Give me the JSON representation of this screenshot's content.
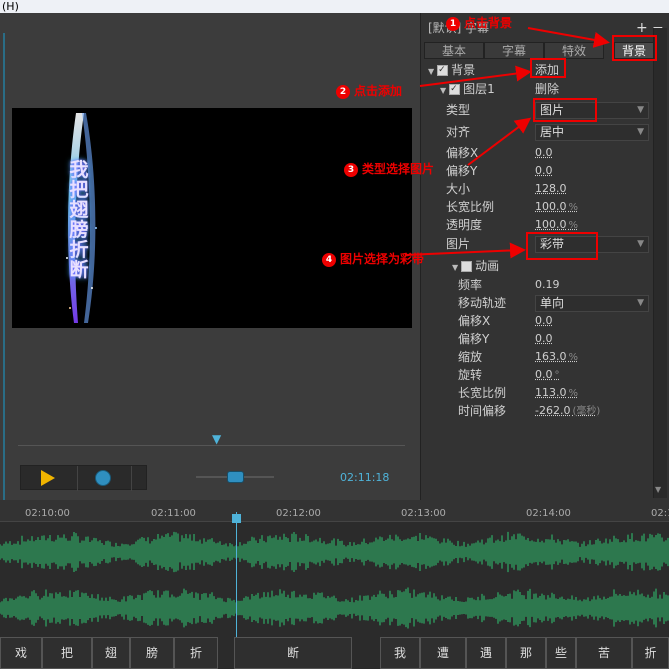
{
  "menu": {
    "label": "(H)"
  },
  "header": {
    "preset": "[默认] 字幕",
    "add": "+",
    "remove": "−"
  },
  "tabs": [
    {
      "label": "基本"
    },
    {
      "label": "字幕"
    },
    {
      "label": "特效"
    },
    {
      "label": "背景"
    }
  ],
  "background": {
    "title": "背景",
    "add_label": "添加",
    "layer_title": "图层1",
    "delete_label": "删除",
    "props": {
      "type": {
        "label": "类型",
        "value": "图片"
      },
      "align": {
        "label": "对齐",
        "value": "居中"
      },
      "offset_x": {
        "label": "偏移X",
        "value": "0.0"
      },
      "offset_y": {
        "label": "偏移Y",
        "value": "0.0"
      },
      "size": {
        "label": "大小",
        "value": "128.0"
      },
      "ratio": {
        "label": "长宽比例",
        "value": "100.0",
        "unit": "%"
      },
      "opacity": {
        "label": "透明度",
        "value": "100.0",
        "unit": "%"
      },
      "image": {
        "label": "图片",
        "value": "彩带"
      }
    }
  },
  "animation": {
    "title": "动画",
    "props": {
      "freq": {
        "label": "频率",
        "value": "0.19"
      },
      "track": {
        "label": "移动轨迹",
        "value": "单向"
      },
      "offset_x": {
        "label": "偏移X",
        "value": "0.0"
      },
      "offset_y": {
        "label": "偏移Y",
        "value": "0.0"
      },
      "scale": {
        "label": "缩放",
        "value": "163.0",
        "unit": "%"
      },
      "rotate": {
        "label": "旋转",
        "value": "0.0",
        "unit": "°"
      },
      "ratio": {
        "label": "长宽比例",
        "value": "113.0",
        "unit": "%"
      },
      "time_offset": {
        "label": "时间偏移",
        "value": "-262.0",
        "unit": "(毫秒)"
      }
    }
  },
  "preview": {
    "vertical_text": "我把翅膀折断"
  },
  "player": {
    "time": "02:11:18",
    "play_icon": "play-icon",
    "record_icon": "record-icon"
  },
  "timeline": {
    "ticks": [
      "02:10:00",
      "02:11:00",
      "02:12:00",
      "02:13:00",
      "02:14:00",
      "02:1"
    ],
    "words": [
      "戏",
      "把",
      "翅",
      "膀",
      "折",
      "断",
      "我",
      "遭",
      "遇",
      "那",
      "些",
      "苦",
      "折"
    ]
  },
  "annotations": {
    "n1": {
      "num": "1",
      "text": "点击背景"
    },
    "n2": {
      "num": "2",
      "text": "点击添加"
    },
    "n3": {
      "num": "3",
      "text": "类型选择图片"
    },
    "n4": {
      "num": "4",
      "text": "图片选择为彩带"
    }
  },
  "colors": {
    "waveform": "#2e8b57",
    "accent": "#4fb3d9",
    "annotation": "#e00000"
  }
}
